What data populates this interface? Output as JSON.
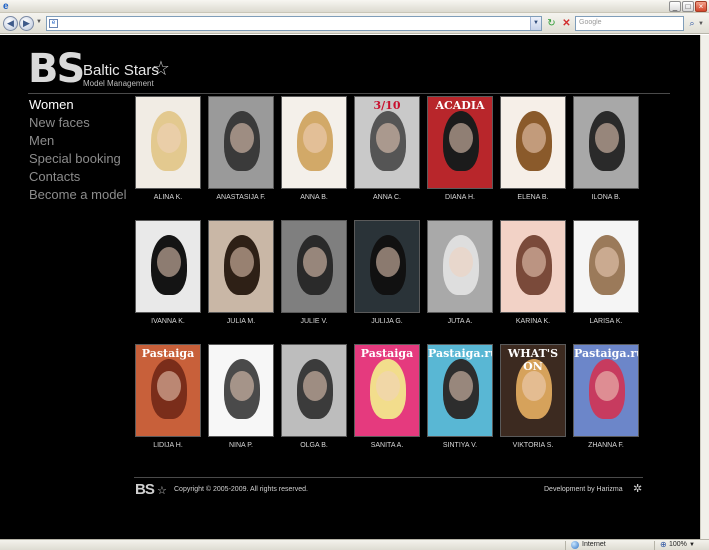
{
  "browser": {
    "search_placeholder": "Google",
    "status_zone": "Internet",
    "zoom": "100%"
  },
  "logo": {
    "monogram": "BS",
    "name": "Baltic Stars",
    "subtitle": "Model Management"
  },
  "menu": [
    {
      "label": "Women"
    },
    {
      "label": "New faces"
    },
    {
      "label": "Men"
    },
    {
      "label": "Special booking"
    },
    {
      "label": "Contacts"
    },
    {
      "label": "Become a model"
    }
  ],
  "models": [
    {
      "name": "ALINA K.",
      "bg": "#f1ece4",
      "hair": "#e3c98f",
      "mag": "",
      "magColor": ""
    },
    {
      "name": "ANASTASIJA F.",
      "bg": "#9a9a9a",
      "hair": "#3a3a3a",
      "mag": "",
      "magColor": ""
    },
    {
      "name": "ANNA B.",
      "bg": "#f4f0ea",
      "hair": "#d2a968",
      "mag": "",
      "magColor": ""
    },
    {
      "name": "ANNA C.",
      "bg": "#c9c9c9",
      "hair": "#555555",
      "mag": "3/10",
      "magColor": "#c8102e"
    },
    {
      "name": "DIANA H.",
      "bg": "#b8262b",
      "hair": "#1b1b1b",
      "mag": "ACADIA",
      "magColor": "#ffffff"
    },
    {
      "name": "ELENA B.",
      "bg": "#f6efe8",
      "hair": "#8a5a2b",
      "mag": "",
      "magColor": ""
    },
    {
      "name": "ILONA B.",
      "bg": "#a8a8a8",
      "hair": "#2a2a2a",
      "mag": "",
      "magColor": ""
    },
    {
      "name": "IVANNA K.",
      "bg": "#e9e9e9",
      "hair": "#141414",
      "mag": "",
      "magColor": ""
    },
    {
      "name": "JULIA M.",
      "bg": "#c9b7a6",
      "hair": "#2e2016",
      "mag": "",
      "magColor": ""
    },
    {
      "name": "JULIE V.",
      "bg": "#7f7f7f",
      "hair": "#2a2a2a",
      "mag": "",
      "magColor": ""
    },
    {
      "name": "JULIJA G.",
      "bg": "#2a3338",
      "hair": "#111111",
      "mag": "",
      "magColor": ""
    },
    {
      "name": "JUTA A.",
      "bg": "#a9a9a9",
      "hair": "#dedede",
      "mag": "",
      "magColor": ""
    },
    {
      "name": "KARINA K.",
      "bg": "#f2d2c6",
      "hair": "#7a4a3a",
      "mag": "",
      "magColor": ""
    },
    {
      "name": "LARISA K.",
      "bg": "#f5f5f5",
      "hair": "#9b7a5a",
      "mag": "",
      "magColor": ""
    },
    {
      "name": "LIDIJA H.",
      "bg": "#c8603a",
      "hair": "#7a2d1a",
      "mag": "Pastaiga",
      "magColor": "#ffffff"
    },
    {
      "name": "NINA P.",
      "bg": "#f7f7f7",
      "hair": "#4a4a4a",
      "mag": "",
      "magColor": ""
    },
    {
      "name": "OLGA B.",
      "bg": "#bdbdbd",
      "hair": "#3b3b3b",
      "mag": "",
      "magColor": ""
    },
    {
      "name": "SANITA A.",
      "bg": "#e53a7e",
      "hair": "#f2dd8c",
      "mag": "Pastaiga",
      "magColor": "#ffffff"
    },
    {
      "name": "SINTIYA V.",
      "bg": "#59b7d4",
      "hair": "#2d2d2d",
      "mag": "Pastaiga.ru",
      "magColor": "#ffffff"
    },
    {
      "name": "VIKTORIA S.",
      "bg": "#3c2a20",
      "hair": "#d6a25b",
      "mag": "WHAT'S ON",
      "magColor": "#ffffff"
    },
    {
      "name": "ZHANNA F.",
      "bg": "#6c86c9",
      "hair": "#c73b5f",
      "mag": "Pastaiga.ru",
      "magColor": "#ffffff"
    }
  ],
  "footer": {
    "logo": "BS",
    "copyright": "Copyright © 2005-2009. All rights reserved.",
    "developer": "Development by Harizma"
  }
}
